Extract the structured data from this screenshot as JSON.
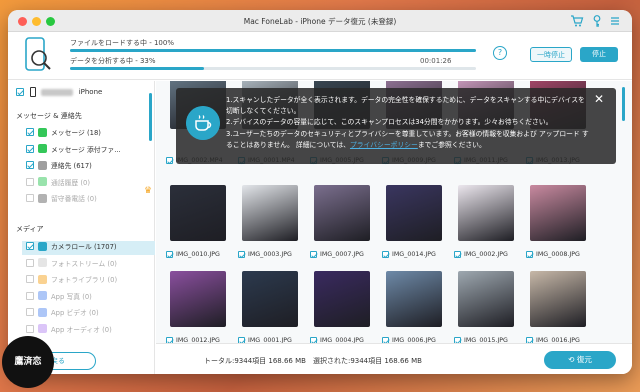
{
  "window": {
    "title": "Mac FoneLab - iPhone データ復元 (未登録)"
  },
  "progress": {
    "load_label": "ファイルをロードする中 - 100%",
    "load_value": 1.0,
    "analyze_label": "データを分析する中 - 33%",
    "analyze_value": 0.33,
    "time": "00:01:26",
    "help": "?",
    "pause_label": "一時停止",
    "stop_label": "停止"
  },
  "sidebar": {
    "device_name": "iPhone",
    "sections": [
      {
        "title": "メッセージ & 連絡先",
        "items": [
          {
            "label": "メッセージ (18)",
            "checked": true,
            "enabled": true,
            "icon_color": "#34c759"
          },
          {
            "label": "メッセージ 添付ファ...",
            "checked": true,
            "enabled": true,
            "icon_color": "#34c759"
          },
          {
            "label": "連絡先 (617)",
            "checked": true,
            "enabled": true,
            "icon_color": "#9e9e9e"
          },
          {
            "label": "通話履歴 (0)",
            "checked": false,
            "enabled": false,
            "icon_color": "#34c759"
          },
          {
            "label": "留守番電話 (0)",
            "checked": false,
            "enabled": false,
            "icon_color": "#666666"
          }
        ]
      },
      {
        "title": "メディア",
        "items": [
          {
            "label": "カメラロール (1707)",
            "checked": true,
            "enabled": true,
            "selected": true,
            "icon_color": "#2aa6c8"
          },
          {
            "label": "フォトストリーム (0)",
            "checked": false,
            "enabled": false,
            "icon_color": "#cccccc"
          },
          {
            "label": "フォトライブラリ (0)",
            "checked": false,
            "enabled": false,
            "icon_color": "#f5a623"
          },
          {
            "label": "App 写真 (0)",
            "checked": false,
            "enabled": false,
            "icon_color": "#5b8def"
          },
          {
            "label": "App ビデオ (0)",
            "checked": false,
            "enabled": false,
            "icon_color": "#5b8def"
          },
          {
            "label": "App オーディオ (0)",
            "checked": false,
            "enabled": false,
            "icon_color": "#b78cf2"
          }
        ]
      }
    ],
    "back_label": "戻る"
  },
  "overlay": {
    "line1": "1.スキャンしたデータが全く表示されます。データの完全性を確保するために、データをスキャンする中にデバイスを",
    "line2": "切断しなくてください。",
    "line3": "2.デバイスのデータの容量に応じて、このスキャンプロセスは34分間をかかります。少々お待ちください。",
    "line4": "3.ユーザーたちのデータのセキュリティとプライバシーを尊重しています。お客様の情報を収集および アップロード す",
    "line5_a": "ることはありません。 詳細については、",
    "line5_link": "プライバシーポリシー",
    "line5_b": "までご参照ください。"
  },
  "grid": {
    "row0": [
      "IMG_0002.MP4",
      "IMG_0001.MP4",
      "IMG_0005.JPG",
      "IMG_0009.JPG",
      "IMG_0011.JPG",
      "IMG_0013.JPG"
    ],
    "row1": [
      "IMG_0010.JPG",
      "IMG_0003.JPG",
      "IMG_0007.JPG",
      "IMG_0014.JPG",
      "IMG_0002.JPG",
      "IMG_0008.JPG"
    ],
    "row2": [
      "IMG_0012.JPG",
      "IMG_0001.JPG",
      "IMG_0004.JPG",
      "IMG_0006.JPG",
      "IMG_0015.JPG",
      "IMG_0016.JPG"
    ]
  },
  "footer": {
    "total": "トータル:9344項目 168.66 MB　選択された:9344項目 168.66 MB",
    "restore_label": "復元"
  },
  "watermark": "鷹済恋"
}
